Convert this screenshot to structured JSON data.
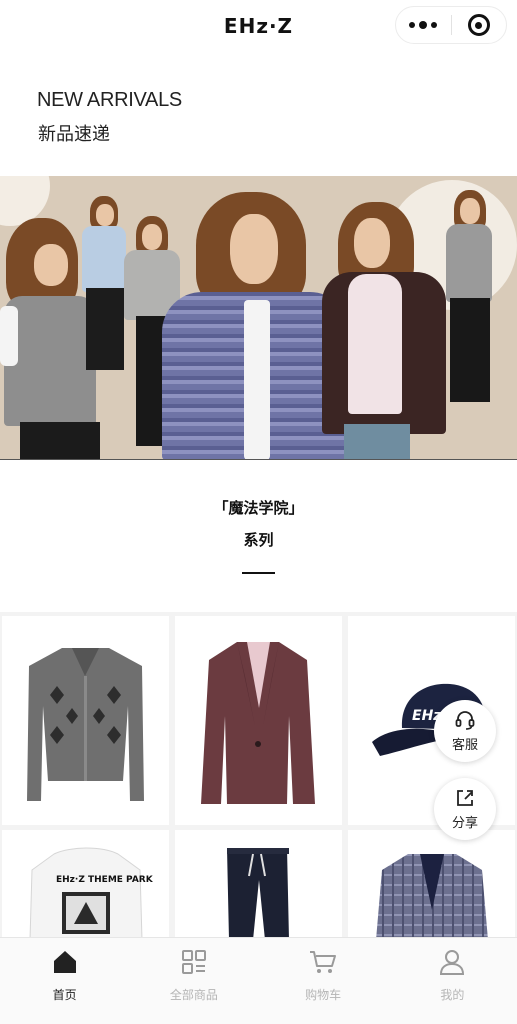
{
  "header": {
    "brand": "EHz·Z"
  },
  "hero": {
    "title_en": "NEW ARRIVALS",
    "title_cn": "新品速递"
  },
  "series": {
    "title": "「魔法学院」",
    "subtitle": "系列"
  },
  "floating": {
    "service_label": "客服",
    "share_label": "分享"
  },
  "tabs": [
    {
      "label": "首页",
      "icon": "home-icon",
      "active": true
    },
    {
      "label": "全部商品",
      "icon": "grid-icon",
      "active": false
    },
    {
      "label": "购物车",
      "icon": "cart-icon",
      "active": false
    },
    {
      "label": "我的",
      "icon": "user-icon",
      "active": false
    }
  ],
  "colors": {
    "banner_bg": "#d9cbb9",
    "text": "#222222",
    "tab_inactive": "#b5b5b5"
  }
}
